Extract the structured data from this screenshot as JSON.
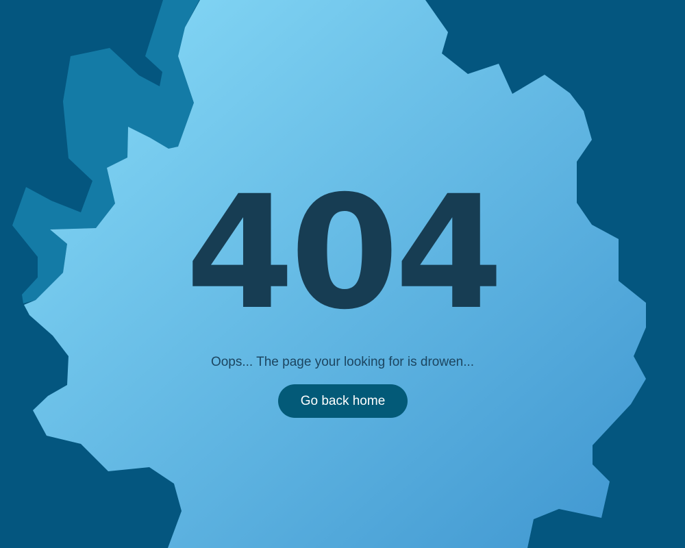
{
  "error": {
    "code": "404",
    "message": "Oops... The page your looking for is drowen..."
  },
  "actions": {
    "home_label": "Go back home"
  },
  "colors": {
    "background": "#04567f",
    "back_layer": "#147ba6",
    "water_light": "#89dcf8",
    "water_dark": "#3f96d0",
    "code_text": "#173d53",
    "message_text": "#1c4560",
    "button_background": "#035a78",
    "button_text": "#ffffff"
  }
}
